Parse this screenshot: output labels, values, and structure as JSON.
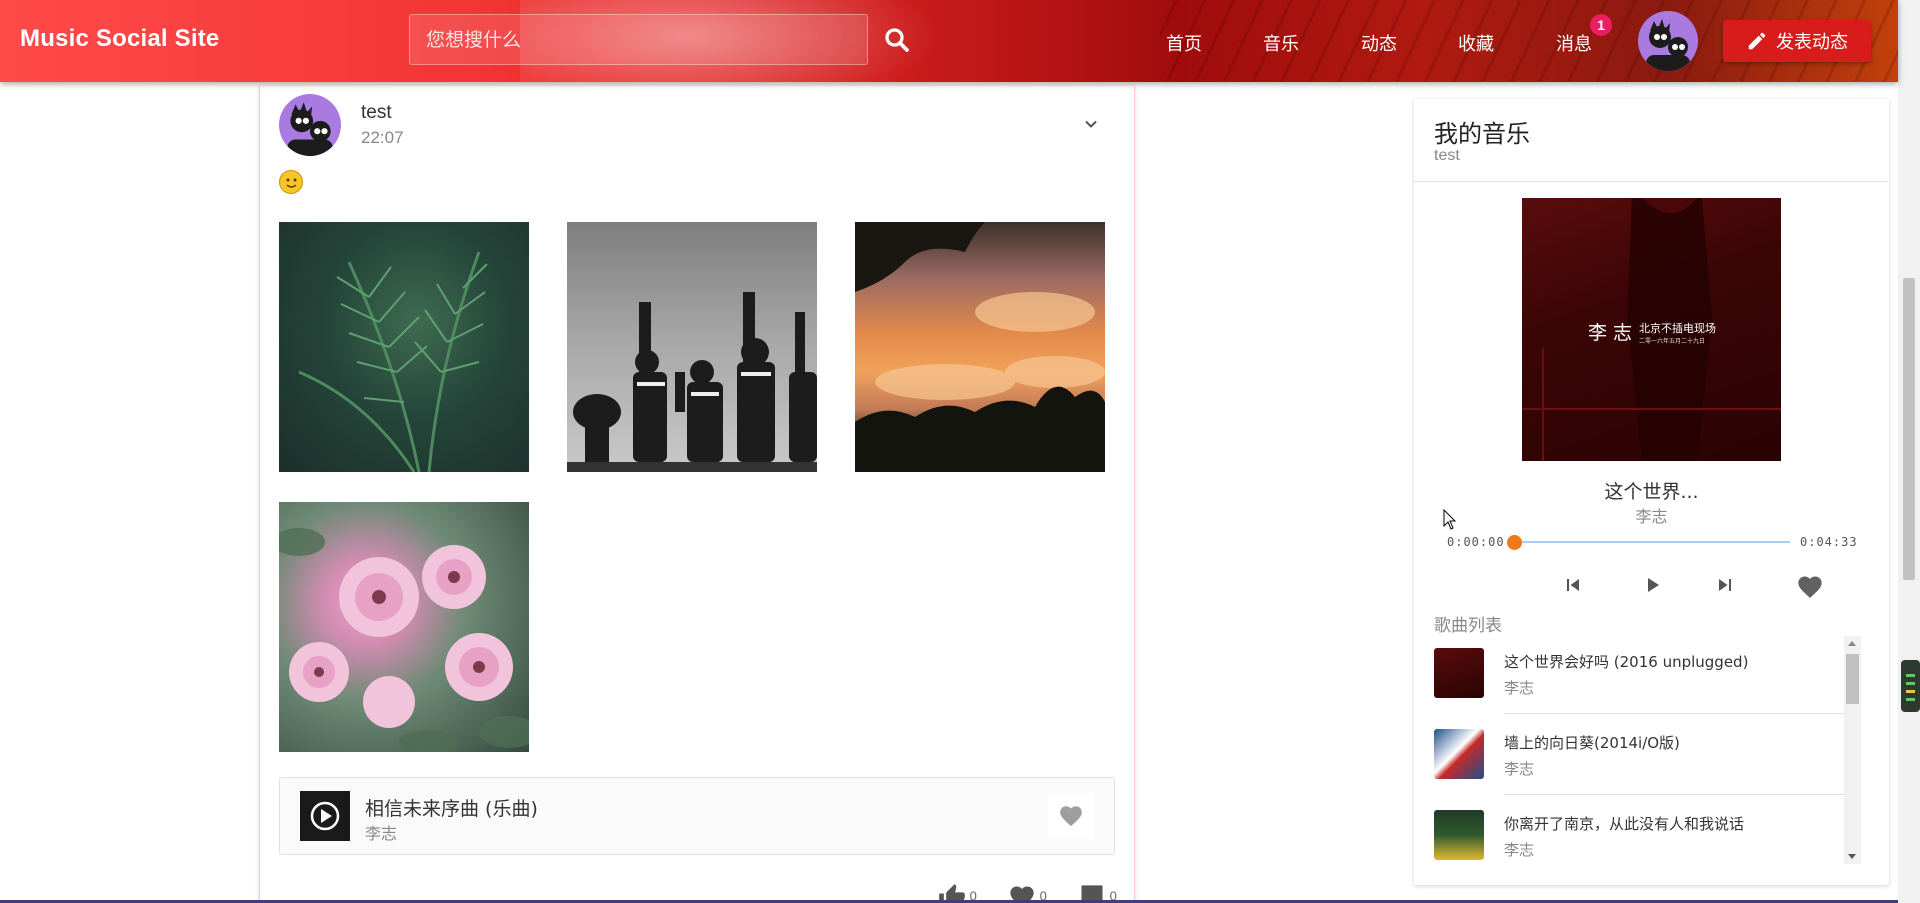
{
  "app": {
    "brand": "Music Social Site"
  },
  "header": {
    "search_placeholder": "您想搜什么",
    "nav": [
      "首页",
      "音乐",
      "动态",
      "收藏",
      "消息"
    ],
    "message_badge": "1",
    "post_button": "发表动态",
    "accent_color": "#d81c1c"
  },
  "post": {
    "user": "test",
    "time": "22:07",
    "emoji": "slightly-smiling-face",
    "photos": [
      "fern-leaves",
      "anime-crew-silhouette",
      "sunset-clouds",
      "pink-roses"
    ],
    "music": {
      "title": "相信未来序曲 (乐曲)",
      "artist": "李志"
    },
    "actions": {
      "likes": "0",
      "favorites": "0",
      "comments": "0"
    }
  },
  "panel": {
    "title": "我的音乐",
    "subtitle": "test",
    "now_playing": {
      "title": "这个世界...",
      "artist": "李志",
      "current_time": "0:00:00",
      "total_time": "0:04:33",
      "progress": 0
    },
    "album_text": {
      "artist": "李 志",
      "line1": "北京不插电现场",
      "line2": "二零一六年五月二十九日"
    },
    "list_label": "歌曲列表",
    "songs": [
      {
        "title": "这个世界会好吗 (2016 unplugged)",
        "artist": "李志"
      },
      {
        "title": "墙上的向日葵(2014i/O版)",
        "artist": "李志"
      },
      {
        "title": "你离开了南京，从此没有人和我说话",
        "artist": "李志"
      }
    ]
  }
}
